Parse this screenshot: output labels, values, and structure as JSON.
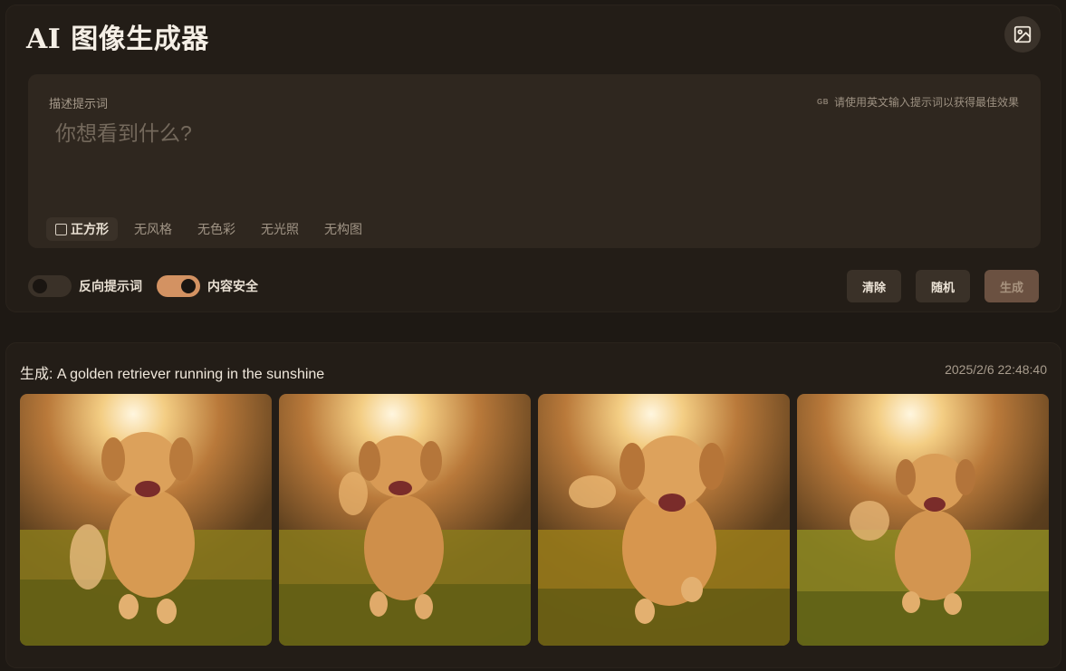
{
  "app": {
    "title": "AI 图像生成器"
  },
  "header": {
    "gallery_icon": "image-icon"
  },
  "prompt": {
    "label": "描述提示词",
    "hint_icon": "GB",
    "hint": "请使用英文输入提示词以获得最佳效果",
    "placeholder": "你想看到什么?",
    "value": ""
  },
  "chips": [
    {
      "label": "正方形",
      "checked": false
    },
    {
      "label": "无风格"
    },
    {
      "label": "无色彩"
    },
    {
      "label": "无光照"
    },
    {
      "label": "无构图"
    }
  ],
  "toggles": [
    {
      "label": "反向提示词",
      "on": false
    },
    {
      "label": "内容安全",
      "on": true
    }
  ],
  "actions": {
    "clear": "清除",
    "random": "随机",
    "generate": "生成"
  },
  "result": {
    "title": "生成: A golden retriever running in the sunshine",
    "timestamp": "2025/2/6 22:48:40",
    "image_count": 4
  },
  "colors": {
    "accent": "#d39262",
    "background": "#1e1914",
    "panel": "#231d17"
  }
}
